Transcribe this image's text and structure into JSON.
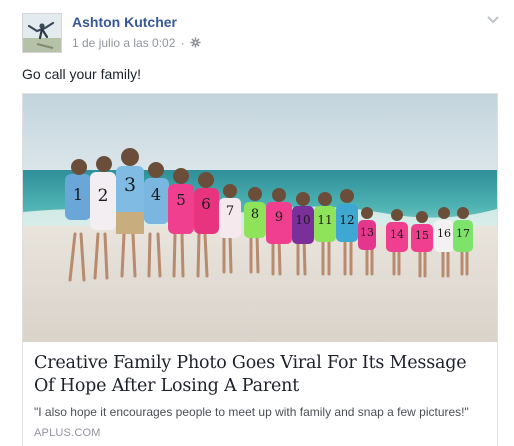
{
  "post": {
    "author": "Ashton Kutcher",
    "timestamp": "1 de julio a las 0:02",
    "separator": "·",
    "privacy_icon": "gear-icon",
    "menu_icon": "chevron-down-icon",
    "text": "Go call your family!"
  },
  "link": {
    "title": "Creative Family Photo Goes Viral For Its Message Of Hope After Losing A Parent",
    "description": "\"I also hope it encourages people to meet up with family and snap a few pictures!\"",
    "domain": "APLUS.COM",
    "photo_numbers": [
      "1",
      "2",
      "3",
      "4",
      "5",
      "6",
      "7",
      "8",
      "9",
      "10",
      "11",
      "12",
      "13",
      "14",
      "15",
      "16",
      "17"
    ]
  },
  "colors": {
    "author_link": "#365899",
    "meta": "#90949c",
    "border": "#dddfe2",
    "text": "#1d2129"
  }
}
